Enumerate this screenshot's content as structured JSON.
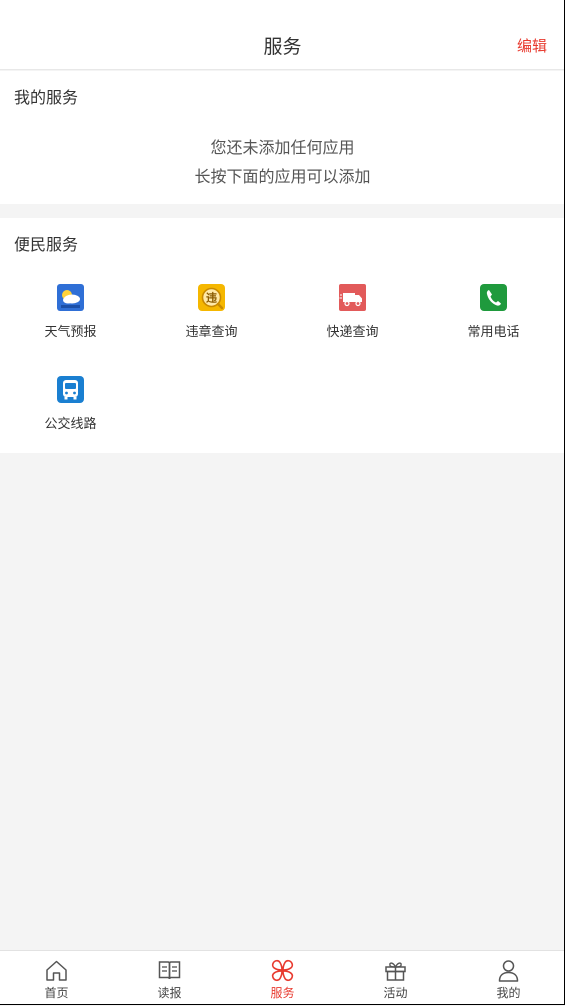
{
  "header": {
    "title": "服务",
    "edit_label": "编辑"
  },
  "my_services": {
    "title": "我的服务",
    "empty_line1": "您还未添加任何应用",
    "empty_line2": "长按下面的应用可以添加"
  },
  "convenience_services": {
    "title": "便民服务",
    "items": [
      {
        "label": "天气预报",
        "icon": "weather-icon",
        "color": "#2f6fd6"
      },
      {
        "label": "违章查询",
        "icon": "violation-icon",
        "color": "#f5b700"
      },
      {
        "label": "快递查询",
        "icon": "delivery-truck-icon",
        "color": "#e25a5a"
      },
      {
        "label": "常用电话",
        "icon": "phone-icon",
        "color": "#1f9a3d"
      },
      {
        "label": "公交线路",
        "icon": "bus-icon",
        "color": "#1a7fd1"
      }
    ]
  },
  "tabbar": {
    "items": [
      {
        "label": "首页",
        "icon": "home-icon"
      },
      {
        "label": "读报",
        "icon": "newspaper-icon"
      },
      {
        "label": "服务",
        "icon": "services-icon",
        "active": true
      },
      {
        "label": "活动",
        "icon": "gift-icon"
      },
      {
        "label": "我的",
        "icon": "user-icon"
      }
    ]
  },
  "colors": {
    "accent": "#e83a2f",
    "background": "#f4f4f4"
  }
}
